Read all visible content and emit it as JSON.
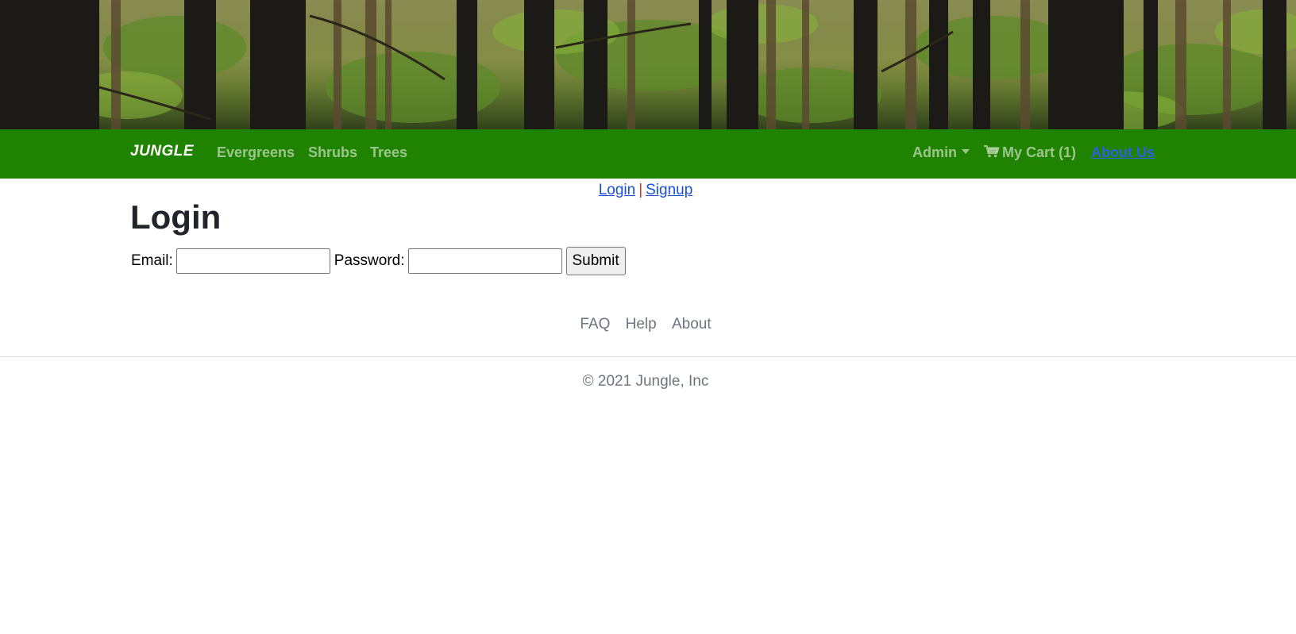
{
  "navbar": {
    "brand": "JUNGLE",
    "links": [
      "Evergreens",
      "Shrubs",
      "Trees"
    ],
    "admin_label": "Admin",
    "cart_label": "My Cart (1)",
    "about_label": "About Us"
  },
  "auth": {
    "login_link": "Login",
    "separator": "|",
    "signup_link": "Signup"
  },
  "login": {
    "title": "Login",
    "email_label": "Email:",
    "email_value": "",
    "password_label": "Password:",
    "password_value": "",
    "submit_label": "Submit"
  },
  "footer": {
    "links": [
      "FAQ",
      "Help",
      "About"
    ],
    "copyright": "© 2021 Jungle, Inc"
  },
  "icons": {
    "cart": "cart-icon",
    "dropdown": "chevron-down-icon"
  },
  "colors": {
    "navbar_bg": "#1f8200",
    "link_blue": "#1a4fd8",
    "muted_text": "#6c757d"
  }
}
